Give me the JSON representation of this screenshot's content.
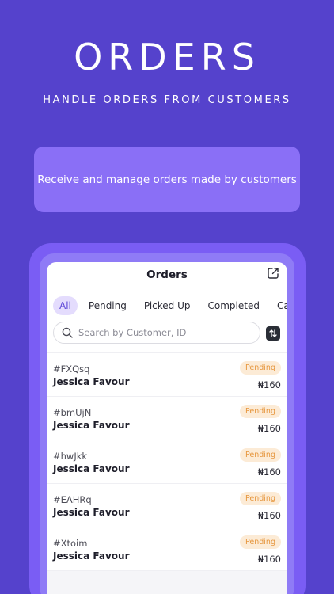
{
  "hero": {
    "title": "ORDERS",
    "subtitle": "HANDLE ORDERS FROM CUSTOMERS",
    "banner": "Receive and manage orders made by customers"
  },
  "screen": {
    "title": "Orders",
    "tabs": [
      {
        "label": "All",
        "active": true
      },
      {
        "label": "Pending",
        "active": false
      },
      {
        "label": "Picked Up",
        "active": false
      },
      {
        "label": "Completed",
        "active": false
      },
      {
        "label": "Ca",
        "active": false
      }
    ],
    "search": {
      "placeholder": "Search by Customer, ID",
      "value": ""
    },
    "orders": [
      {
        "id": "#FXQsq",
        "customer": "Jessica Favour",
        "status": "Pending",
        "amount": "₦160"
      },
      {
        "id": "#bmUjN",
        "customer": "Jessica Favour",
        "status": "Pending",
        "amount": "₦160"
      },
      {
        "id": "#hwJkk",
        "customer": "Jessica Favour",
        "status": "Pending",
        "amount": "₦160"
      },
      {
        "id": "#EAHRq",
        "customer": "Jessica Favour",
        "status": "Pending",
        "amount": "₦160"
      },
      {
        "id": "#Xtoim",
        "customer": "Jessica Favour",
        "status": "Pending",
        "amount": "₦160"
      }
    ]
  },
  "icons": {
    "export": "export-icon",
    "search": "search-icon",
    "sort": "sort-icon"
  },
  "colors": {
    "background": "#5542cc",
    "banner": "#8a6ff6",
    "accent": "#5b45d6",
    "tab_active_bg": "#e4dcfd",
    "pending_bg": "#fcebd6",
    "pending_text": "#e6973f"
  }
}
